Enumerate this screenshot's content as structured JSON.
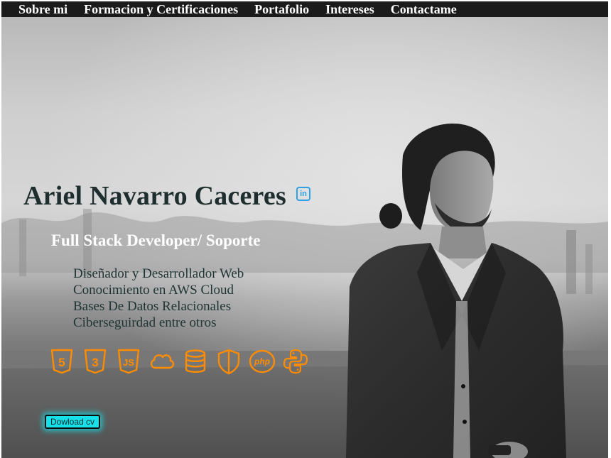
{
  "nav": {
    "items": [
      "Sobre mi",
      "Formacion y Certificaciones",
      "Portafolio",
      "Intereses",
      "Contactame"
    ]
  },
  "hero": {
    "name": "Ariel Navarro Caceres",
    "linkedin_icon": "linkedin-icon",
    "linkedin_glyph": "in",
    "role": "Full Stack Developer/ Soporte",
    "skills": [
      "Diseñador y Desarrollador Web",
      "Conocimiento en AWS Cloud",
      "Bases De Datos Relacionales",
      "Ciberseguirdad entre otros"
    ],
    "tech_icons": [
      "html5-icon",
      "css3-icon",
      "javascript-icon",
      "cloud-icon",
      "database-icon",
      "shield-icon",
      "php-icon",
      "python-icon"
    ],
    "tech_glyphs": {
      "html5": "5",
      "css3": "3",
      "js": "JS",
      "php": "php"
    },
    "cv_button": "Dowload cv"
  },
  "colors": {
    "nav_bg": "#1b1b1b",
    "name": "#1e2d2d",
    "icons": "#ff8c00",
    "linkedin": "#2ea0e6",
    "button": "#17e0e8"
  }
}
